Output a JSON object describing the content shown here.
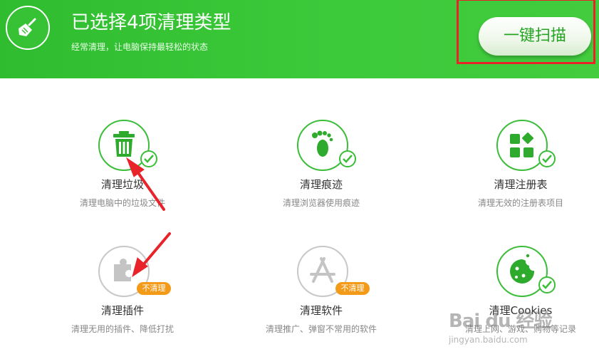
{
  "header": {
    "title": "已选择4项清理类型",
    "subtitle": "经常清理，让电脑保持最轻松的状态",
    "scan_button": "一键扫描",
    "logo_icon": "broom-icon"
  },
  "items": [
    {
      "title": "清理垃圾",
      "desc": "清理电脑中的垃圾文件",
      "icon": "trash-icon",
      "selected": true
    },
    {
      "title": "清理痕迹",
      "desc": "清理浏览器使用痕迹",
      "icon": "footprint-icon",
      "selected": true
    },
    {
      "title": "清理注册表",
      "desc": "清理无效的注册表项目",
      "icon": "registry-icon",
      "selected": true
    },
    {
      "title": "清理插件",
      "desc": "清理无用的插件、降低打扰",
      "icon": "puzzle-icon",
      "selected": false,
      "tag": "不清理"
    },
    {
      "title": "清理软件",
      "desc": "清理推广、弹窗不常用的软件",
      "icon": "app-store-icon",
      "selected": false,
      "tag": "不清理"
    },
    {
      "title": "清理Cookies",
      "desc": "清理上网、游戏、购物等记录",
      "icon": "cookie-icon",
      "selected": true
    }
  ],
  "watermark": {
    "brand": "Bai du 经验",
    "site": "jingyan.baidu.com"
  },
  "colors": {
    "green": "#3cbd39",
    "orange": "#f39a18",
    "annotation_red": "#e8232a"
  }
}
